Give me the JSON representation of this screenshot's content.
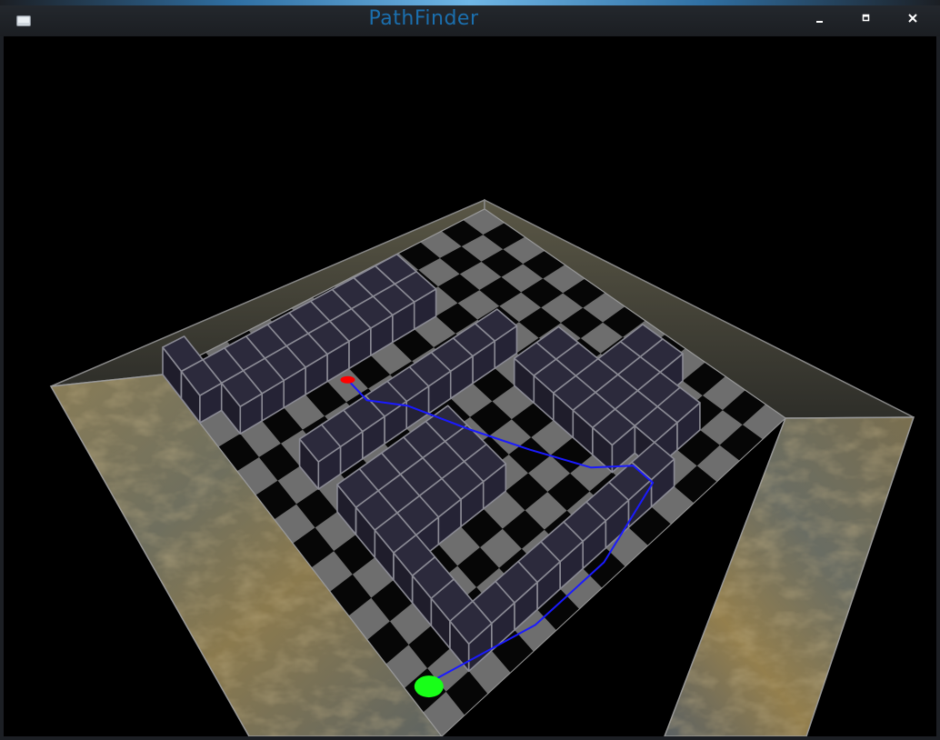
{
  "window": {
    "title": "PathFinder",
    "icons": {
      "app": "window-icon",
      "minimize": "minimize-icon",
      "maximize": "maximize-icon",
      "close": "close-icon"
    }
  },
  "scene": {
    "grid_size": [
      15,
      15
    ],
    "walls": [
      "...............",
      ".........##....",
      ".........####..",
      ".......######..",
      ".....#.#####.#.",
      ".##..#.......#.",
      ".##..#.......#.",
      ".##..#.......#.",
      ".##..#.###...#.",
      ".##..#.###...#.",
      ".##..#.###...#.",
      ".##..#.###...#.",
      ".##..#.#######.",
      ".##............",
      "##............."
    ],
    "start_cell": [
      9,
      3
    ],
    "goal_cell": [
      14,
      13
    ],
    "path": [
      [
        9,
        3
      ],
      [
        9,
        4
      ],
      [
        8,
        5
      ],
      [
        7,
        7
      ],
      [
        6,
        9
      ],
      [
        5,
        11
      ],
      [
        4,
        12
      ],
      [
        4,
        13
      ],
      [
        7,
        14
      ],
      [
        10,
        14
      ],
      [
        14,
        13
      ]
    ],
    "colors": {
      "background": "#000000",
      "floor_light": "#6e6e6e",
      "floor_dark": "#060606",
      "cube_top": "#2c2a3c",
      "cube_side_left": "#1f1d2b",
      "cube_side_right": "#252335",
      "cube_edge": "#8a8a94",
      "border_ground": "#7d7354",
      "border_wall": "#3c3b33",
      "path_line": "#1a1aff",
      "start_marker": "#ff0000",
      "goal_marker": "#18ff18"
    }
  }
}
